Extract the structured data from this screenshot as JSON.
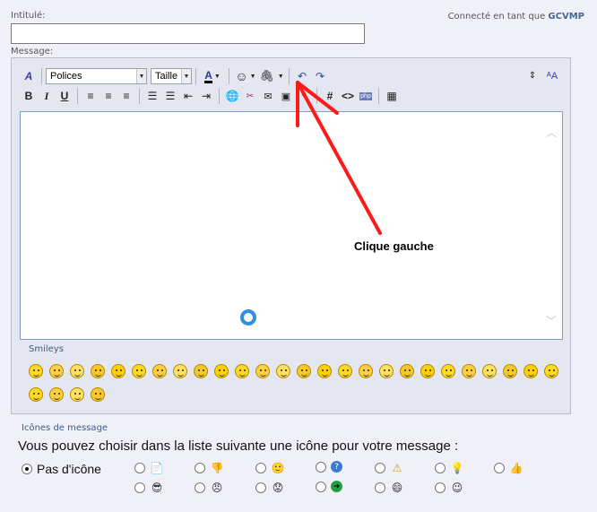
{
  "form": {
    "title_label": "Intitulé:",
    "message_label": "Message:",
    "connected_prefix": "Connecté en tant que",
    "username": "GCVMP"
  },
  "toolbar": {
    "font_select": "Polices",
    "size_select": "Taille"
  },
  "annotation": {
    "text": "Clique gauche",
    "arrow_color": "#ff1a1a"
  },
  "smileys": {
    "label": "Smileys",
    "row1_count": 26,
    "row2_count": 4
  },
  "message_icons": {
    "label": "Icônes de message",
    "instruction": "Vous pouvez choisir dans la liste suivante une icône pour votre message :",
    "none_option": "Pas d'icône"
  },
  "colors": {
    "accent": "#3d5a8a",
    "spinner": "#2f8fe0",
    "editor_border": "#7aa0c8"
  }
}
